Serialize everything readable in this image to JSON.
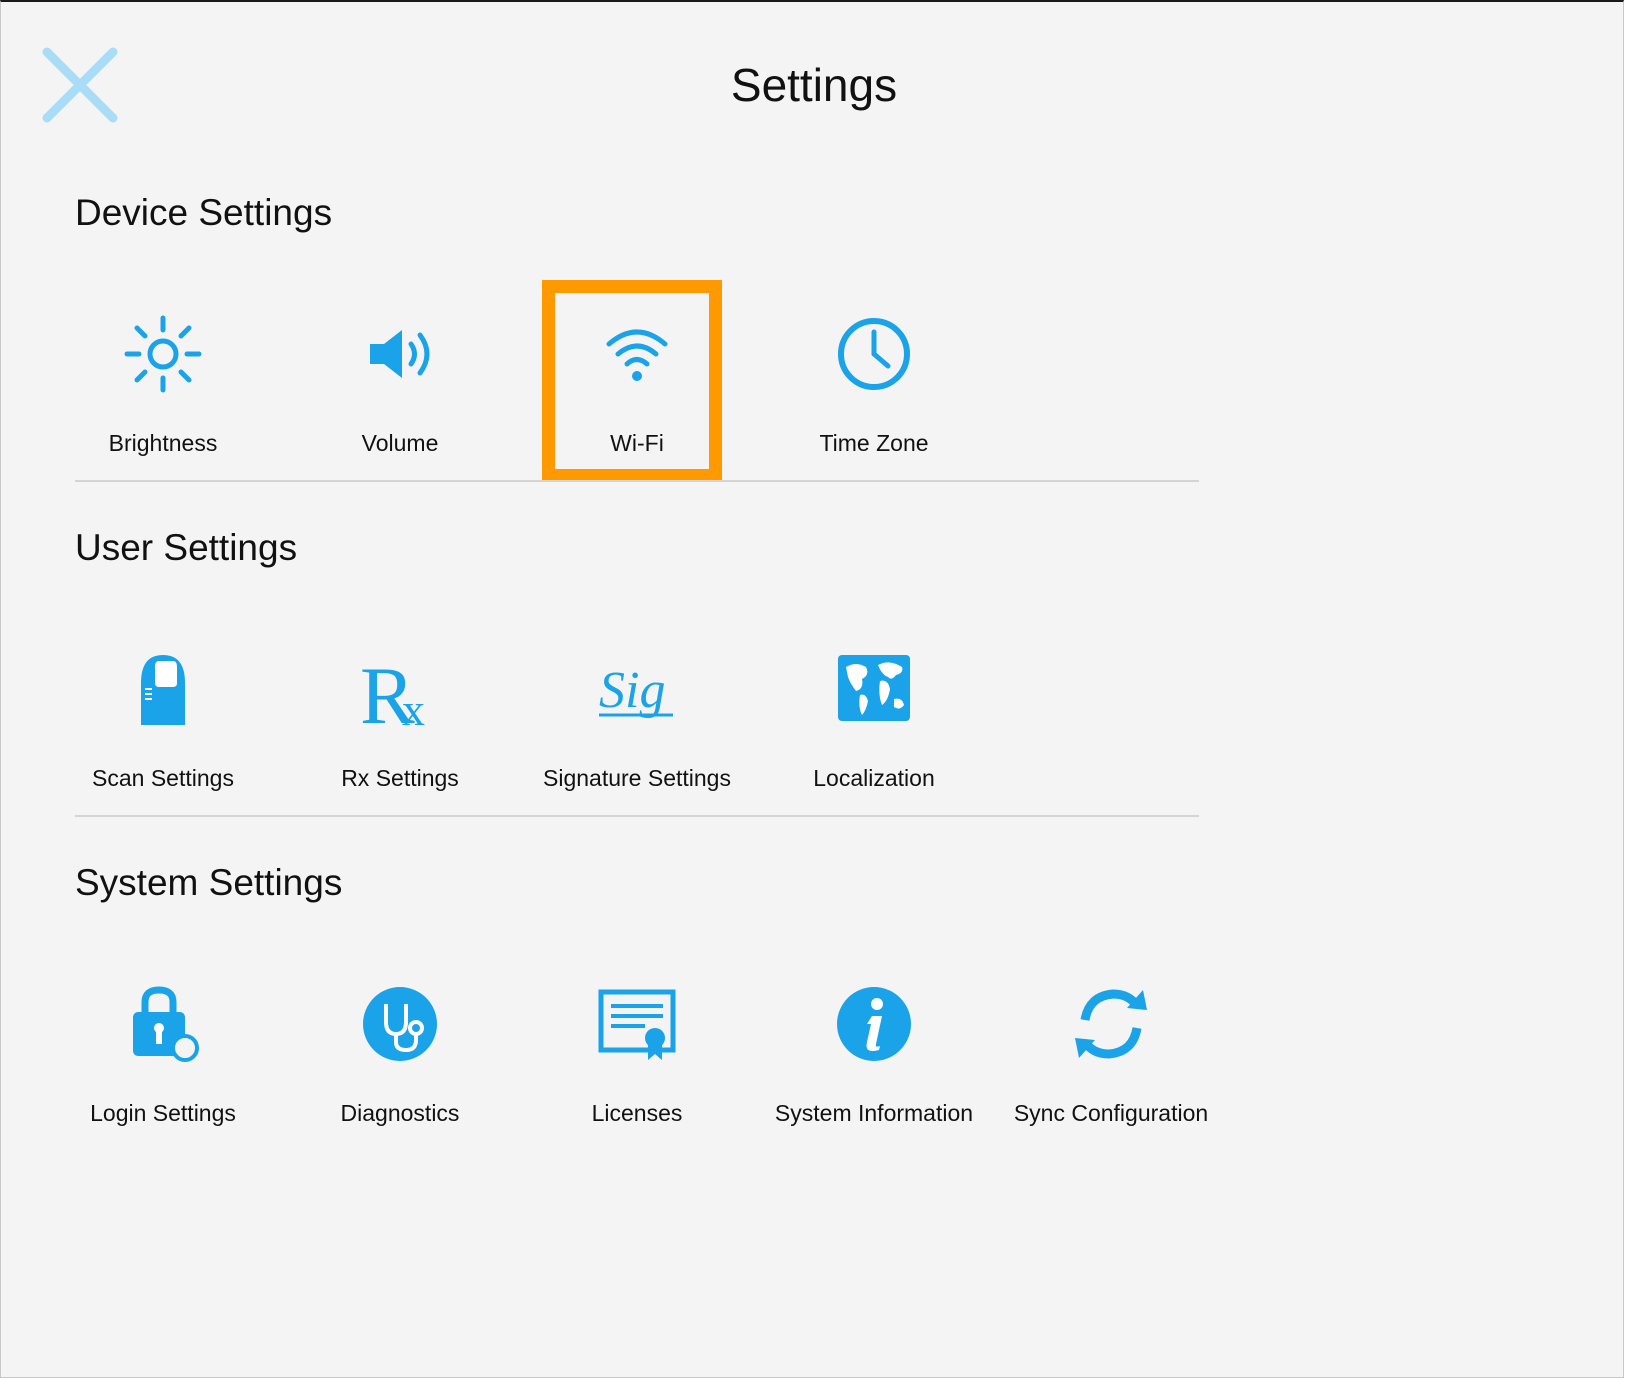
{
  "title": "Settings",
  "accent_color": "#1aa3e8",
  "highlight_color": "#ff9900",
  "close_icon": "close-icon",
  "sections": [
    {
      "title": "Device Settings",
      "items": [
        {
          "label": "Brightness",
          "icon": "brightness-icon"
        },
        {
          "label": "Volume",
          "icon": "volume-icon"
        },
        {
          "label": "Wi-Fi",
          "icon": "wifi-icon",
          "highlighted": true
        },
        {
          "label": "Time Zone",
          "icon": "clock-icon"
        }
      ]
    },
    {
      "title": "User Settings",
      "items": [
        {
          "label": "Scan Settings",
          "icon": "fingerprint-scan-icon"
        },
        {
          "label": "Rx Settings",
          "icon": "rx-icon"
        },
        {
          "label": "Signature Settings",
          "icon": "signature-icon"
        },
        {
          "label": "Localization",
          "icon": "world-map-icon"
        }
      ]
    },
    {
      "title": "System Settings",
      "items": [
        {
          "label": "Login Settings",
          "icon": "lock-icon"
        },
        {
          "label": "Diagnostics",
          "icon": "stethoscope-icon"
        },
        {
          "label": "Licenses",
          "icon": "certificate-icon"
        },
        {
          "label": "System Information",
          "icon": "info-icon"
        },
        {
          "label": "Sync Configuration",
          "icon": "sync-icon"
        }
      ]
    }
  ]
}
